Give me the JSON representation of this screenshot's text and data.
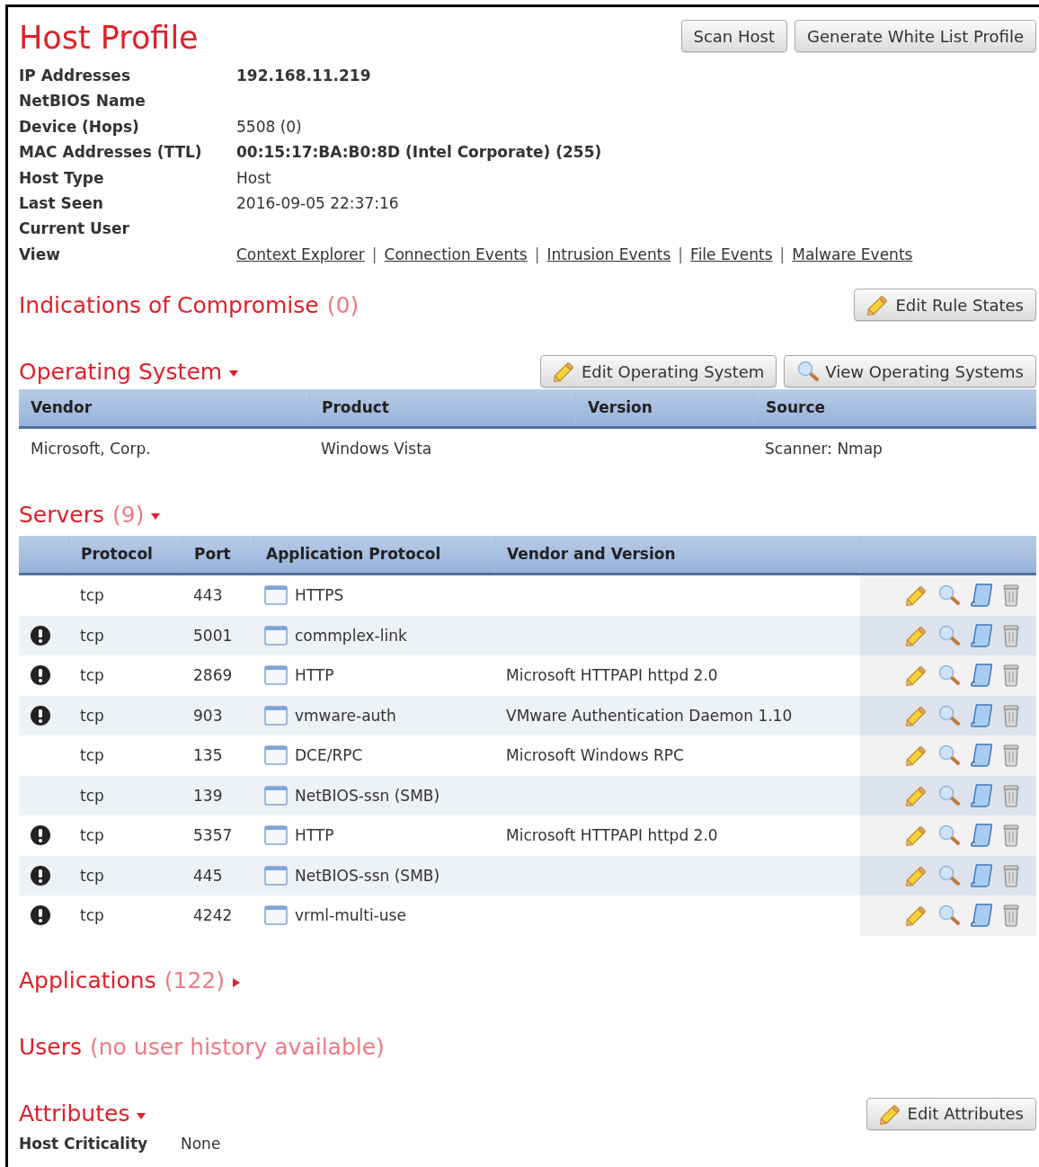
{
  "title": "Host Profile",
  "header_buttons": [
    {
      "label": "Scan Host"
    },
    {
      "label": "Generate White List Profile"
    }
  ],
  "details": [
    {
      "label": "IP Addresses",
      "value": "192.168.11.219",
      "bold": true
    },
    {
      "label": "NetBIOS Name"
    },
    {
      "label": "Device (Hops)",
      "value": "5508 (0)",
      "bold": false
    },
    {
      "label": "MAC Addresses (TTL)",
      "value": "00:15:17:BA:B0:8D (Intel Corporate) (255)",
      "bold": true
    },
    {
      "label": "Host Type",
      "value": "Host",
      "bold": false
    },
    {
      "label": "Last Seen",
      "value": "2016-09-05 22:37:16",
      "bold": false
    },
    {
      "label": "Current User"
    },
    {
      "label": "View",
      "links": [
        "Context Explorer",
        "Connection Events",
        "Intrusion Events",
        "File Events",
        "Malware Events"
      ],
      "separator": "|"
    }
  ],
  "ioc": {
    "title": "Indications of Compromise",
    "count": "(0)",
    "buttons": [
      {
        "label": "Edit Rule States",
        "kind": "edit"
      }
    ]
  },
  "operating_system": {
    "title": "Operating System",
    "expanded": true,
    "buttons": [
      {
        "label": "Edit Operating System",
        "kind": "edit"
      },
      {
        "label": "View Operating Systems",
        "kind": "view"
      }
    ],
    "columns": [
      "Vendor",
      "Product",
      "Version",
      "Source"
    ],
    "rows": [
      [
        "Microsoft, Corp.",
        "Windows Vista",
        "",
        "Scanner: Nmap"
      ]
    ]
  },
  "servers": {
    "title": "Servers",
    "count": "(9)",
    "expanded": true,
    "columns": [
      "Protocol",
      "Port",
      "Application Protocol",
      "Vendor and Version"
    ],
    "rows": [
      {
        "alert": false,
        "protocol": "tcp",
        "port": "443",
        "application": "HTTPS"
      },
      {
        "alert": true,
        "protocol": "tcp",
        "port": "5001",
        "application": "commplex-link"
      },
      {
        "alert": true,
        "protocol": "tcp",
        "port": "2869",
        "application": "HTTP",
        "vendor": "Microsoft HTTPAPI httpd 2.0"
      },
      {
        "alert": true,
        "protocol": "tcp",
        "port": "903",
        "application": "vmware-auth",
        "vendor": "VMware Authentication Daemon 1.10"
      },
      {
        "alert": false,
        "protocol": "tcp",
        "port": "135",
        "application": "DCE/RPC",
        "vendor": "Microsoft Windows RPC"
      },
      {
        "alert": false,
        "protocol": "tcp",
        "port": "139",
        "application": "NetBIOS-ssn (SMB)"
      },
      {
        "alert": true,
        "protocol": "tcp",
        "port": "5357",
        "application": "HTTP",
        "vendor": "Microsoft HTTPAPI httpd 2.0"
      },
      {
        "alert": true,
        "protocol": "tcp",
        "port": "445",
        "application": "NetBIOS-ssn (SMB)"
      },
      {
        "alert": true,
        "protocol": "tcp",
        "port": "4242",
        "application": "vrml-multi-use"
      }
    ]
  },
  "applications": {
    "title": "Applications",
    "count": "(122)",
    "expanded": false
  },
  "users": {
    "title": "Users",
    "count": "(no user history available)"
  },
  "attributes": {
    "title": "Attributes",
    "expanded": true,
    "buttons": [
      {
        "label": "Edit Attributes",
        "kind": "edit"
      }
    ],
    "items": [
      {
        "label": "Host Criticality",
        "value": "None"
      }
    ]
  }
}
